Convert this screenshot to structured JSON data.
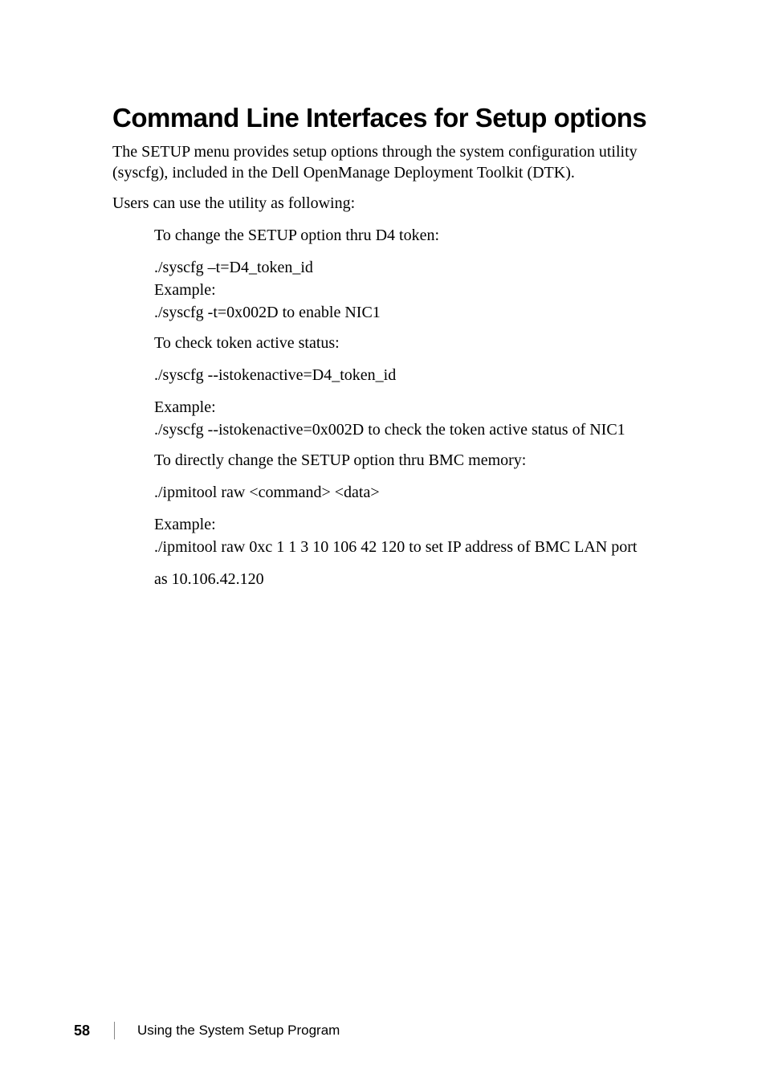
{
  "heading": "Command Line Interfaces for Setup options",
  "intro": "The SETUP menu provides setup options through the system configuration utility (syscfg), included in the Dell OpenManage Deployment Toolkit (DTK).",
  "users_line": "Users can use the utility as following:",
  "block1": {
    "title": "To change the SETUP option thru D4 token:",
    "cmd1": "./syscfg –t=D4_token_id",
    "example_label": "Example:",
    "cmd2": "./syscfg -t=0x002D to enable NIC1"
  },
  "block2": {
    "title": "To check token active status:",
    "cmd1": "./syscfg --istokenactive=D4_token_id",
    "example_label": "Example:",
    "cmd2": "./syscfg --istokenactive=0x002D to check the token active status of NIC1"
  },
  "block3": {
    "title": "To directly change the SETUP option thru BMC memory:",
    "cmd1": "./ipmitool raw <command> <data>",
    "example_label": "Example:",
    "cmd2": "./ipmitool raw 0xc 1 1 3 10 106 42 120 to set IP address of BMC LAN port",
    "cmd3": "as 10.106.42.120"
  },
  "footer": {
    "page_number": "58",
    "section": "Using the System Setup Program"
  }
}
